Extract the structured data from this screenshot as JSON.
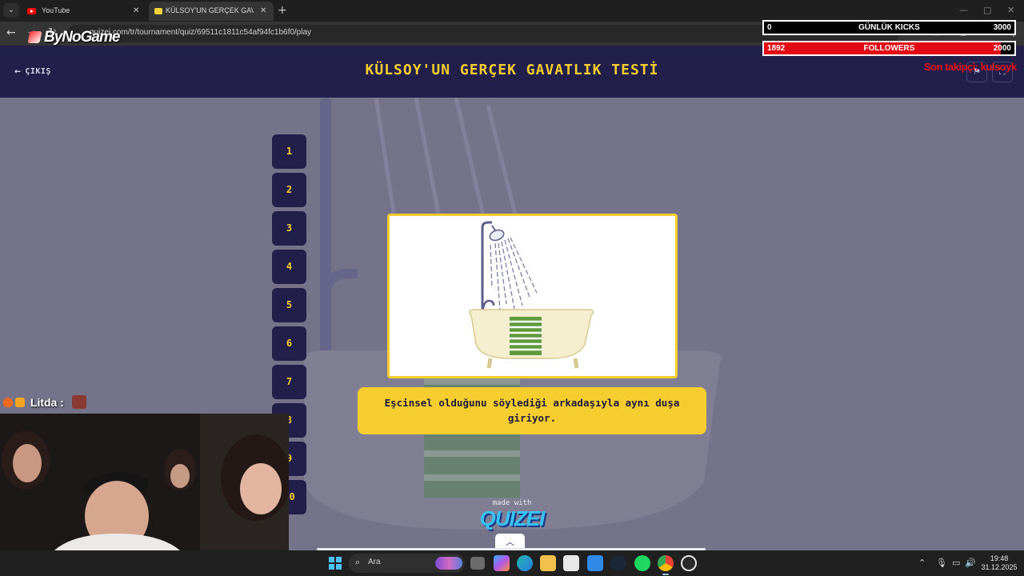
{
  "browser": {
    "tabs": [
      {
        "title": "YouTube",
        "active": false
      },
      {
        "title": "KÜLSOY'UN GERÇEK GAVATLIK",
        "active": true
      }
    ],
    "new_tab_label": "+",
    "url": "quizei.com/tr/tournament/quiz/69511c1811c54af94fc1b6f0/play",
    "icons": [
      "back-arrow-icon",
      "forward-arrow-icon",
      "reload-icon",
      "bookmark-star-icon",
      "extensions-icon",
      "menu-icon"
    ]
  },
  "overlay": {
    "brand": "ByNoGame",
    "kicks_bar": {
      "current": "0",
      "label": "GÜNLÜK KICKS",
      "goal": "3000",
      "progress": 0.0
    },
    "followers_bar": {
      "current": "1892",
      "label": "FOLLOWERS",
      "goal": "2000",
      "progress": 0.946
    },
    "last_follower_text": "Son takipçi: kulsoyk",
    "bar_fill_color": "#e00914"
  },
  "quiz": {
    "exit_label": "ÇIKIŞ",
    "title": "KÜLSOY'UN GERÇEK GAVATLIK TESTİ",
    "header_icons": [
      "flag-icon",
      "fullscreen-icon"
    ],
    "question_numbers": [
      "1",
      "2",
      "3",
      "4",
      "5",
      "6",
      "7",
      "8",
      "9",
      "10"
    ],
    "question_text": "Eşcinsel olduğunu söylediği arkadaşıyla aynı duşa giriyor.",
    "image_subject": "shower-bathtub-illustration",
    "made_with_label": "made with",
    "logo_text": "QUIZEI",
    "accent_color": "#f6cd2f",
    "header_color": "#221f4a"
  },
  "chat": {
    "username": "Litda :",
    "emotes": [
      "flame-emote",
      "crown-emote",
      "face-emote"
    ]
  },
  "webcam": {
    "subject": "streamer-webcam"
  },
  "taskbar": {
    "search_placeholder": "Ara",
    "apps": [
      "task-view-icon",
      "copilot-icon",
      "edge-icon",
      "file-explorer-icon",
      "store-icon",
      "mail-icon",
      "steam-icon",
      "spotify-icon",
      "chrome-icon",
      "chatgpt-icon"
    ],
    "tray_icons": [
      "chevron-up-icon",
      "microphone-icon",
      "display-icon",
      "volume-icon"
    ],
    "time": "19:48",
    "date": "31.12.2025"
  }
}
